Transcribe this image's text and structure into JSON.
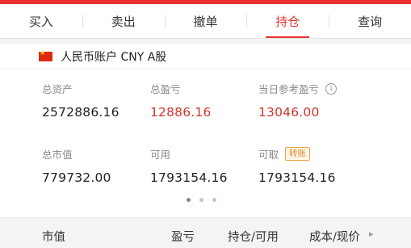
{
  "tabs": [
    {
      "label": "买入"
    },
    {
      "label": "卖出"
    },
    {
      "label": "撤单"
    },
    {
      "label": "持仓"
    },
    {
      "label": "查询"
    }
  ],
  "account": {
    "label": "人民币账户 CNY A股"
  },
  "summary": {
    "total_assets_label": "总资产",
    "total_assets_value": "2572886.16",
    "total_pnl_label": "总盈亏",
    "total_pnl_value": "12886.16",
    "today_pnl_label": "当日参考盈亏",
    "today_pnl_value": "13046.00",
    "market_value_label": "总市值",
    "market_value_value": "779732.00",
    "available_label": "可用",
    "available_value": "1793154.16",
    "withdrawable_label": "可取",
    "withdrawable_value": "1793154.16",
    "transfer_badge": "转账"
  },
  "colors": {
    "accent": "#e8302e",
    "profit": "#d0342c",
    "badge": "#d98a2b"
  },
  "table_header": {
    "market_value": "市值",
    "pnl": "盈亏",
    "position_available": "持仓/可用",
    "cost_price": "成本/现价"
  }
}
